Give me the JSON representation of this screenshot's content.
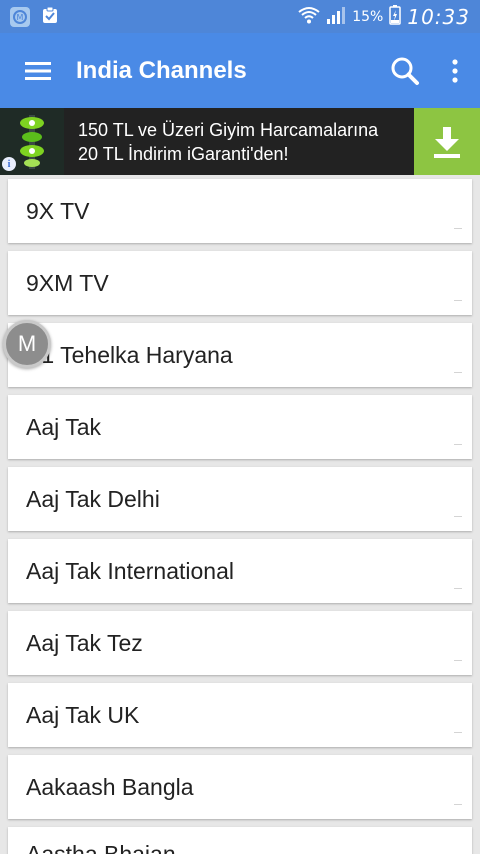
{
  "status_bar": {
    "battery_percent": "15%",
    "time": "10:33",
    "icons": [
      "app-notification-icon",
      "clipboard-check-icon",
      "wifi-icon",
      "signal-icon",
      "battery-charging-icon"
    ]
  },
  "app_bar": {
    "title": "India Channels",
    "menu_icon": "hamburger-menu-icon",
    "search_icon": "search-icon",
    "overflow_icon": "more-vert-icon"
  },
  "ad": {
    "line1": "150 TL ve Üzeri Giyim Harcamalarına",
    "line2": "20 TL İndirim iGaranti'den!",
    "info_label": "i",
    "download_icon": "download-icon",
    "colors": {
      "download_bg": "#8dc542"
    }
  },
  "floating_bubble": {
    "label": "M"
  },
  "channels": [
    {
      "label": "9X TV"
    },
    {
      "label": "9XM TV"
    },
    {
      "label": "A1 Tehelka Haryana"
    },
    {
      "label": "Aaj Tak"
    },
    {
      "label": "Aaj Tak Delhi"
    },
    {
      "label": "Aaj Tak International"
    },
    {
      "label": "Aaj Tak Tez"
    },
    {
      "label": "Aaj Tak UK"
    },
    {
      "label": "Aakaash Bangla"
    },
    {
      "label": "Aastha Bhajan"
    }
  ],
  "colors": {
    "status_bar": "#4e86d8",
    "app_bar": "#4a8ae6",
    "background": "#e7e7e7"
  }
}
